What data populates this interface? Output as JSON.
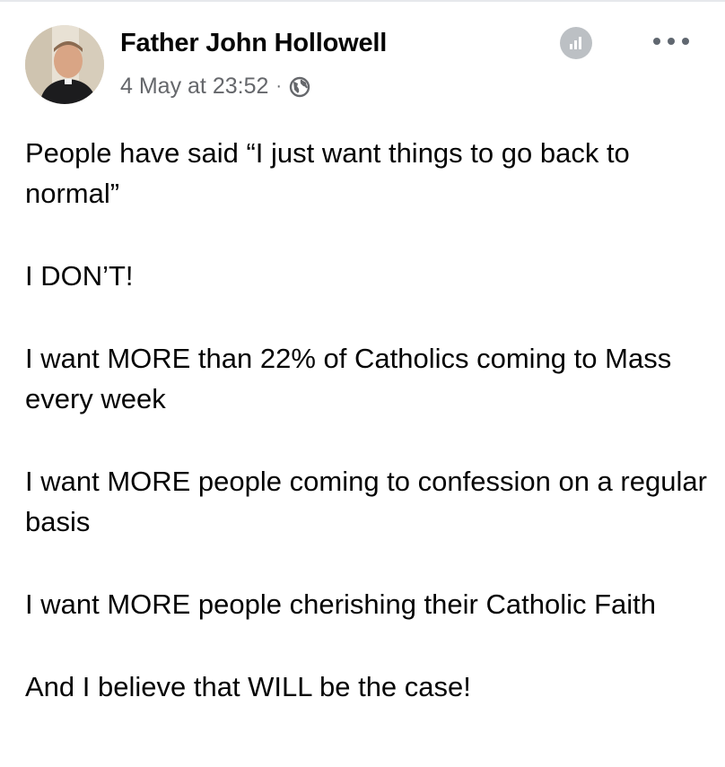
{
  "post": {
    "author": "Father John Hollowell",
    "timestamp": "4 May at 23:52",
    "separator": "·",
    "privacy_icon": "globe-icon",
    "insights_icon": "insights-icon",
    "more_icon": "more-options-icon",
    "paragraphs": [
      "People have said “I just want things to go back to normal”",
      "I DON’T!",
      "I want MORE than 22% of Catholics coming to Mass every week",
      "I want MORE people coming to confession on a regular basis",
      "I want MORE people cherishing their Catholic Faith",
      "And I believe that WILL be the case!"
    ]
  },
  "colors": {
    "text": "#050505",
    "meta": "#65676b",
    "icon_grey": "#bcc0c4"
  }
}
